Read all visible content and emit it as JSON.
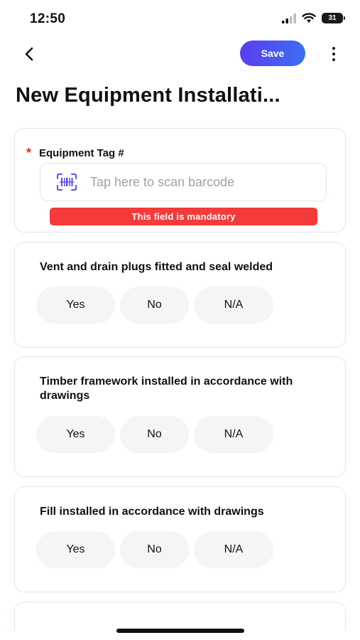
{
  "status_bar": {
    "time": "12:50",
    "battery": "31",
    "icons": [
      "signal-icon",
      "wifi-icon",
      "battery-icon"
    ]
  },
  "nav": {
    "back_icon": "chevron-left-icon",
    "save_label": "Save",
    "more_icon": "more-vertical-icon"
  },
  "page": {
    "title": "New Equipment Installati..."
  },
  "equipment_tag": {
    "required_mark": "*",
    "label": "Equipment Tag #",
    "placeholder": "Tap here to scan barcode",
    "icon": "barcode-scan-icon",
    "error": "This field is mandatory"
  },
  "questions": [
    {
      "text": "Vent and drain plugs fitted and seal welded",
      "options": [
        "Yes",
        "No",
        "N/A"
      ]
    },
    {
      "text": "Timber framework installed in accordance with drawings",
      "options": [
        "Yes",
        "No",
        "N/A"
      ]
    },
    {
      "text": "Fill installed in accordance with drawings",
      "options": [
        "Yes",
        "No",
        "N/A"
      ]
    }
  ],
  "colors": {
    "accent_start": "#5b3cf0",
    "accent_end": "#3a6ff2",
    "error": "#f43a3a",
    "required": "#e52a2a",
    "barcode_icon": "#5a4ee8"
  }
}
